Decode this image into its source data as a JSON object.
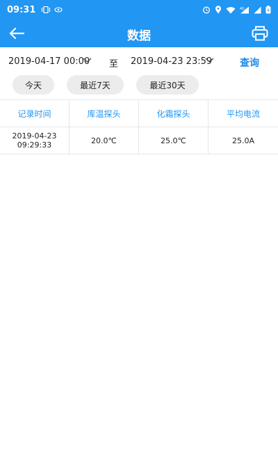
{
  "status": {
    "time": "09:31"
  },
  "header": {
    "title": "数据",
    "back_icon": "arrow-left-icon",
    "print_icon": "print-icon"
  },
  "filter": {
    "start": "2019-04-17 00:00",
    "separator": "至",
    "end": "2019-04-23 23:59",
    "query_label": "查询"
  },
  "quick_ranges": [
    "今天",
    "最近7天",
    "最近30天"
  ],
  "table": {
    "columns": [
      "记录时间",
      "库温探头",
      "化霜探头",
      "平均电流"
    ],
    "rows": [
      {
        "date": "2019-04-23",
        "time": "09:29:33",
        "temp": "20.0℃",
        "defrost": "25.0℃",
        "current": "25.0A"
      }
    ]
  },
  "colors": {
    "primary": "#2196f3",
    "chip_bg": "#ececec",
    "link": "#1e88e5"
  }
}
